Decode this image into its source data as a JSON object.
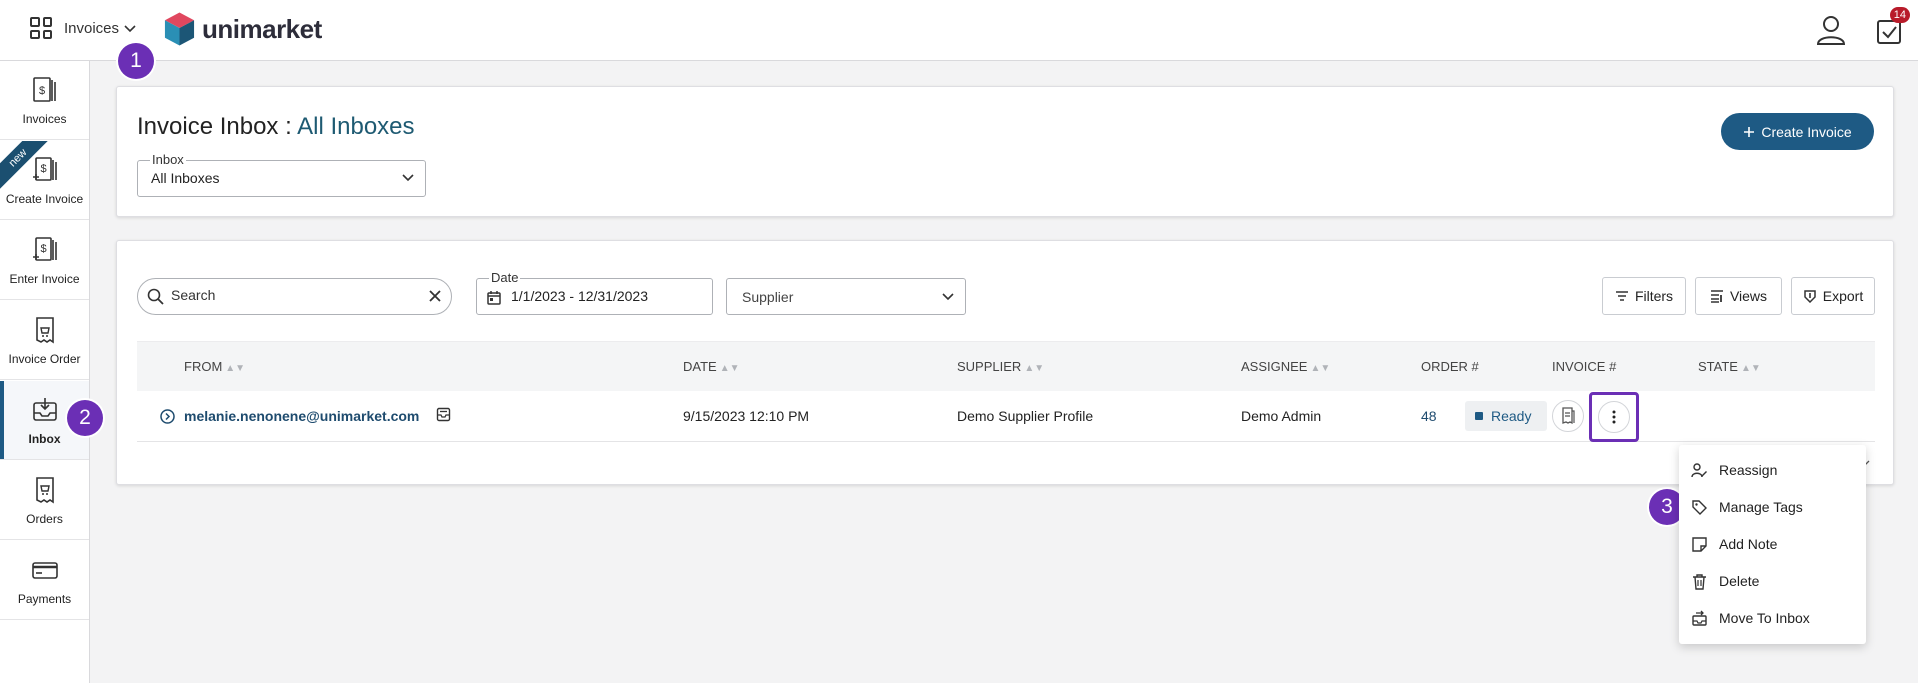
{
  "topbar": {
    "app_switcher_label": "Invoices",
    "logo_text": "unimarket",
    "inbox_badge": "14"
  },
  "steps": [
    "1",
    "2",
    "3"
  ],
  "sidebar": {
    "new_badge": "new",
    "items": [
      {
        "label": "Invoices"
      },
      {
        "label": "Create Invoice"
      },
      {
        "label": "Enter Invoice"
      },
      {
        "label": "Invoice Order"
      },
      {
        "label": "Inbox"
      },
      {
        "label": "Orders"
      },
      {
        "label": "Payments"
      }
    ]
  },
  "header": {
    "title": "Invoice Inbox : ",
    "title_accent": "All Inboxes",
    "inbox_legend": "Inbox",
    "inbox_value": "All Inboxes",
    "create_button": "Create Invoice"
  },
  "toolbar": {
    "search_placeholder": "Search",
    "date_legend": "Date",
    "date_value": "1/1/2023 - 12/31/2023",
    "supplier_placeholder": "Supplier",
    "filters_label": "Filters",
    "views_label": "Views",
    "export_label": "Export"
  },
  "table": {
    "columns": [
      "FROM",
      "DATE",
      "SUPPLIER",
      "ASSIGNEE",
      "ORDER #",
      "INVOICE #",
      "STATE"
    ],
    "rows": [
      {
        "from": "melanie.nenonene@unimarket.com",
        "date": "9/15/2023 12:10 PM",
        "supplier": "Demo Supplier Profile",
        "assignee": "Demo Admin",
        "order": "48",
        "invoice": "",
        "state": "Ready"
      }
    ]
  },
  "menu": {
    "items": [
      {
        "label": "Reassign",
        "icon": "reassign-icon"
      },
      {
        "label": "Manage Tags",
        "icon": "tag-icon"
      },
      {
        "label": "Add Note",
        "icon": "note-icon"
      },
      {
        "label": "Delete",
        "icon": "trash-icon"
      },
      {
        "label": "Move To Inbox",
        "icon": "move-inbox-icon"
      }
    ]
  },
  "colors": {
    "accent": "#1e5a84",
    "step_marker": "#6b2fb5",
    "badge_red": "#b81b2a"
  }
}
